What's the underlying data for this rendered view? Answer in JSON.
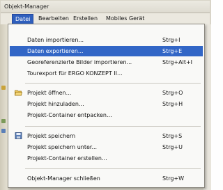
{
  "window": {
    "title": "Objekt-Manager"
  },
  "menubar": {
    "items": [
      {
        "label": "Datei",
        "active": true
      },
      {
        "label": "Bearbeiten",
        "active": false
      },
      {
        "label": "Erstellen",
        "active": false
      },
      {
        "label": "Mobiles Gerät",
        "active": false
      }
    ]
  },
  "menu": {
    "items": [
      {
        "label": "Daten importieren...",
        "shortcut": "Strg+I"
      },
      {
        "label": "Daten exportieren...",
        "shortcut": "Strg+E",
        "highlighted": true
      },
      {
        "label": "Georeferenzierte Bilder importieren...",
        "shortcut": "Strg+Alt+I"
      },
      {
        "label": "Tourexport für ERGO KONZEPT II...",
        "shortcut": ""
      },
      {
        "label": "Projekt öffnen...",
        "shortcut": "Strg+O",
        "icon": "folder-open-icon"
      },
      {
        "label": "Projekt hinzuladen...",
        "shortcut": "Strg+H"
      },
      {
        "label": "Projekt-Container entpacken...",
        "shortcut": ""
      },
      {
        "label": "Projekt speichern",
        "shortcut": "Strg+S",
        "icon": "save-disk-icon"
      },
      {
        "label": "Projekt speichern unter...",
        "shortcut": "Strg+U"
      },
      {
        "label": "Projekt-Container erstellen...",
        "shortcut": ""
      },
      {
        "label": "Objekt-Manager schließen",
        "shortcut": "Strg+W"
      }
    ]
  },
  "colors": {
    "highlight": "#3266c6",
    "menu_background": "#f9f9f7",
    "menubar_active": "#2f5fbd"
  }
}
